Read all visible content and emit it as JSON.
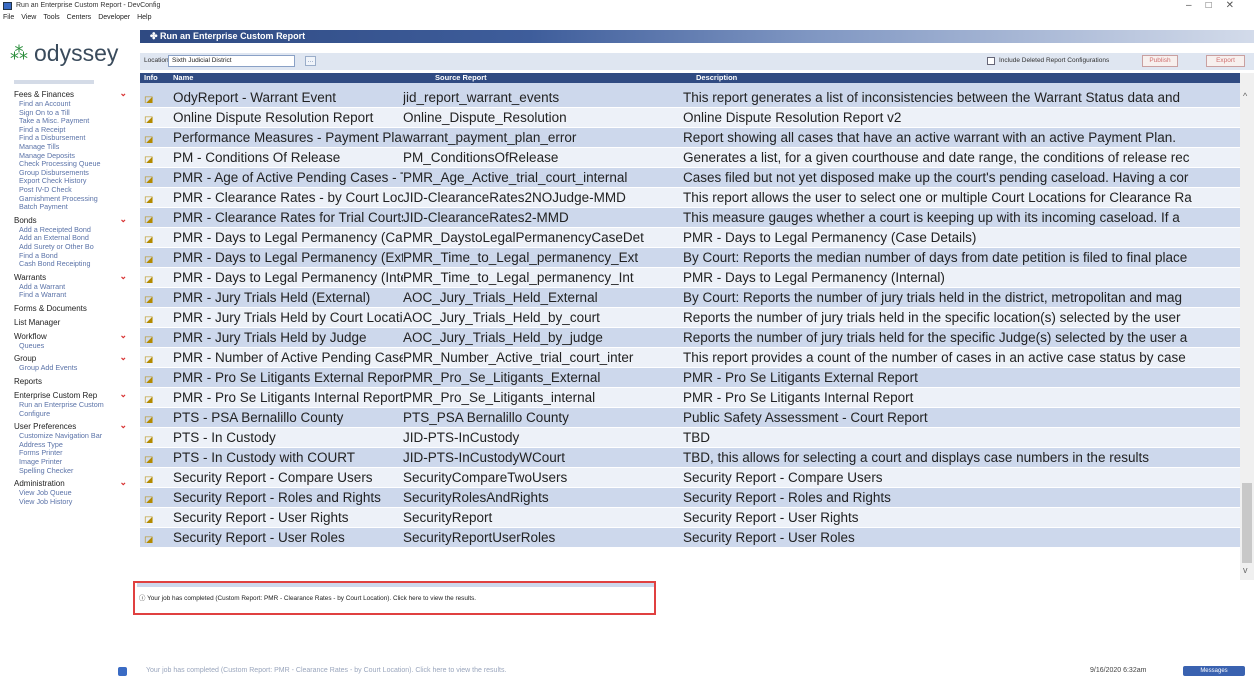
{
  "window": {
    "title": "Run an Enterprise Custom Report - DevConfig"
  },
  "menu": [
    "File",
    "View",
    "Tools",
    "Centers",
    "Developer",
    "Help"
  ],
  "logo": {
    "text": "odyssey"
  },
  "sidebar": {
    "sections": [
      {
        "title": "Fees & Finances",
        "chevron": true,
        "items": [
          "Find an Account",
          "Sign On to a Till",
          "Take a Misc. Payment",
          "Find a Receipt",
          "Find a Disbursement",
          "Manage Tills",
          "Manage Deposits",
          "Check Processing Queue",
          "Group Disbursements",
          "Export Check History",
          "Post IV-D Check",
          "Garnishment Processing",
          "Batch Payment"
        ]
      },
      {
        "title": "Bonds",
        "chevron": true,
        "items": [
          "Add a Receipted Bond",
          "Add an External Bond",
          "Add Surety or Other Bo",
          "Find a Bond",
          "Cash Bond Receipting"
        ]
      },
      {
        "title": "Warrants",
        "chevron": true,
        "items": [
          "Add a Warrant",
          "Find a Warrant"
        ]
      },
      {
        "title": "Forms & Documents",
        "chevron": false,
        "items": []
      },
      {
        "title": "List Manager",
        "chevron": false,
        "items": []
      },
      {
        "title": "Workflow",
        "chevron": true,
        "items": [
          "Queues"
        ]
      },
      {
        "title": "Group",
        "chevron": true,
        "items": [
          "Group Add Events"
        ]
      },
      {
        "title": "Reports",
        "chevron": false,
        "items": []
      },
      {
        "title": "Enterprise Custom Rep",
        "chevron": true,
        "items": [
          "Run an Enterprise Custom",
          "Configure"
        ]
      },
      {
        "title": "User Preferences",
        "chevron": true,
        "items": [
          "Customize Navigation Bar",
          "Address Type",
          "Forms Printer",
          "Image Printer",
          "Spelling Checker"
        ]
      },
      {
        "title": "Administration",
        "chevron": true,
        "items": [
          "View Job Queue",
          "View Job History"
        ]
      }
    ]
  },
  "main": {
    "title": "Run an Enterprise Custom Report",
    "location_label": "Location",
    "location_value": "Sixth Judicial District",
    "include_deleted_label": "Include Deleted Report Configurations",
    "publish_label": "Publish",
    "export_label": "Export"
  },
  "table": {
    "headers": {
      "info": "Info",
      "name": "Name",
      "source": "Source Report",
      "description": "Description"
    },
    "rows": [
      {
        "name": "OdyReport - Warrant Event",
        "source": "jid_report_warrant_events",
        "description": "This report generates a list of inconsistencies between the Warrant Status data and"
      },
      {
        "name": "Online Dispute Resolution Report",
        "source": "Online_Dispute_Resolution",
        "description": "Online Dispute Resolution Report v2"
      },
      {
        "name": "Performance Measures - Payment Plan",
        "source": "warrant_payment_plan_error",
        "description": "Report showing all cases that have an active warrant with an active Payment Plan."
      },
      {
        "name": "PM - Conditions Of Release",
        "source": "PM_ConditionsOfRelease",
        "description": "Generates a list, for a given courthouse and date range, the conditions of release rec"
      },
      {
        "name": "PMR - Age of Active Pending Cases - T",
        "source": "PMR_Age_Active_trial_court_internal",
        "description": "Cases filed but not yet disposed make up the court's pending caseload. Having a cor"
      },
      {
        "name": "PMR - Clearance Rates - by Court Loca",
        "source": "JID-ClearanceRates2NOJudge-MMD",
        "description": "This report allows the user to select one or multiple Court Locations for Clearance Ra"
      },
      {
        "name": "PMR - Clearance Rates for Trial Courts",
        "source": "JID-ClearanceRates2-MMD",
        "description": "This measure gauges whether a court is keeping up with its incoming caseload. If a"
      },
      {
        "name": "PMR - Days to Legal Permanency (Cas",
        "source": "PMR_DaystoLegalPermanencyCaseDet",
        "description": "PMR - Days to Legal Permanency (Case Details)"
      },
      {
        "name": "PMR - Days to Legal Permanency (Ext",
        "source": "PMR_Time_to_Legal_permanency_Ext",
        "description": "By Court: Reports the median number of days from date petition is filed to final place"
      },
      {
        "name": "PMR - Days to Legal Permanency (Inte",
        "source": "PMR_Time_to_Legal_permanency_Int",
        "description": "PMR - Days to Legal Permanency (Internal)"
      },
      {
        "name": "PMR - Jury Trials Held (External)",
        "source": "AOC_Jury_Trials_Held_External",
        "description": "By Court: Reports the number of jury trials held in the district, metropolitan and mag"
      },
      {
        "name": "PMR - Jury Trials Held by Court Locatic",
        "source": "AOC_Jury_Trials_Held_by_court",
        "description": "Reports the number of jury trials held in the specific location(s) selected by the user"
      },
      {
        "name": "PMR - Jury Trials Held by Judge",
        "source": "AOC_Jury_Trials_Held_by_judge",
        "description": "Reports the number of jury trials held for the specific Judge(s) selected by the user a"
      },
      {
        "name": "PMR - Number of Active Pending Case",
        "source": "PMR_Number_Active_trial_court_inter",
        "description": "This report provides a count of the number of cases in an active case status by case"
      },
      {
        "name": "PMR - Pro Se Litigants External Report",
        "source": "PMR_Pro_Se_Litigants_External",
        "description": "PMR - Pro Se Litigants External Report"
      },
      {
        "name": "PMR - Pro Se Litigants Internal Report",
        "source": "PMR_Pro_Se_Litigants_internal",
        "description": "PMR - Pro Se Litigants Internal Report"
      },
      {
        "name": "PTS - PSA Bernalillo County",
        "source": "PTS_PSA Bernalillo County",
        "description": "Public Safety Assessment - Court Report"
      },
      {
        "name": "PTS - In Custody",
        "source": "JID-PTS-InCustody",
        "description": "TBD"
      },
      {
        "name": "PTS - In Custody with COURT",
        "source": "JID-PTS-InCustodyWCourt",
        "description": "TBD, this allows for selecting a court and displays case numbers in the results"
      },
      {
        "name": "Security Report - Compare Users",
        "source": "SecurityCompareTwoUsers",
        "description": "Security Report - Compare Users"
      },
      {
        "name": "Security Report - Roles and Rights",
        "source": "SecurityRolesAndRights",
        "description": "Security Report - Roles and Rights"
      },
      {
        "name": "Security Report - User Rights",
        "source": "SecurityReport",
        "description": "Security Report - User Rights"
      },
      {
        "name": "Security Report - User Roles",
        "source": "SecurityReportUserRoles",
        "description": "Security Report - User Roles"
      }
    ]
  },
  "notification": {
    "message": "Your job has completed (Custom Report: PMR - Clearance Rates - by Court Location).  Click here to view the results."
  },
  "status": {
    "message": "Your job has completed (Custom Report: PMR - Clearance Rates - by Court Location).  Click here to view the results.",
    "datetime": "9/16/2020 6:32am",
    "messages_label": "Messages"
  }
}
